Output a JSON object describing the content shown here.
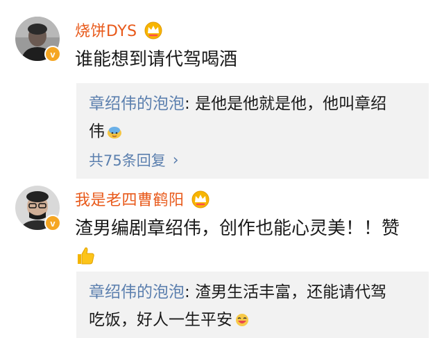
{
  "comments": [
    {
      "username": "烧饼DYS",
      "text": "谁能想到请代驾喝酒",
      "verified_mark": "v",
      "reply": {
        "author": "章绍伟的泡泡",
        "separator": ": ",
        "text_line1": "是他是他就是他，他叫章绍",
        "text_line2": "伟"
      },
      "more_replies": "共75条回复"
    },
    {
      "username": "我是老四曹鹤阳",
      "text": "渣男编剧章绍伟，创作也能心灵美！！赞",
      "verified_mark": "v",
      "reply": {
        "author": "章绍伟的泡泡",
        "separator": ": ",
        "text_line1": "渣男生活丰富，还能请代驾",
        "text_line2": "吃饭，好人一生平安"
      }
    }
  ],
  "icons": {
    "crown": "crown-icon",
    "verified": "verified-badge-icon",
    "chevron": "chevron-right-icon",
    "thumbs_up": "thumbs-up-icon"
  },
  "colors": {
    "username": "#e8591a",
    "reply_author": "#5b7fae",
    "reply_bg": "#f2f2f2",
    "verified_badge": "#f5a623"
  }
}
